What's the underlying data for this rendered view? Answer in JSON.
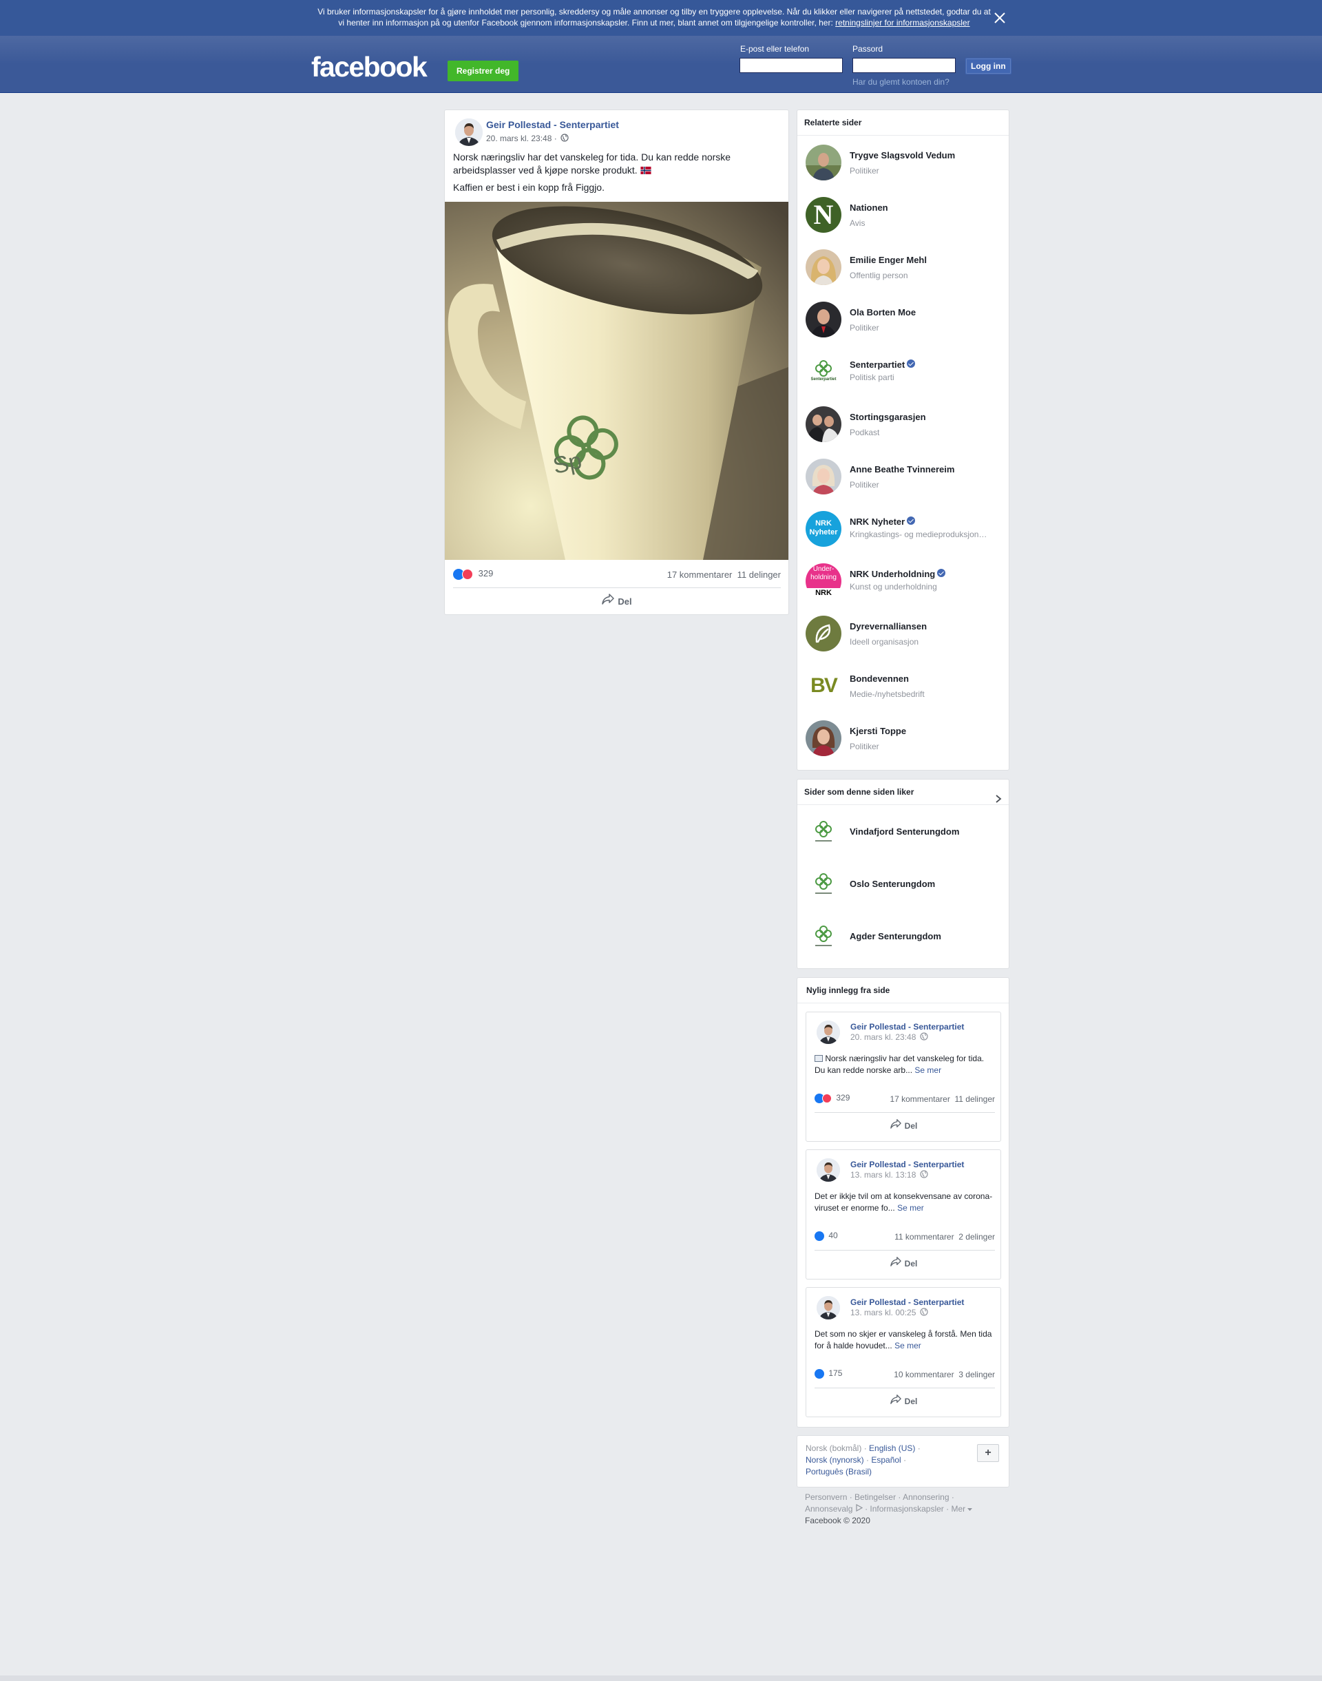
{
  "cookie_banner": {
    "line1": "Vi bruker informasjonskapsler for å gjøre innholdet mer personlig, skreddersy og måle annonser og tilby en tryggere opplevelse. Når du klikker eller navigerer på nettstedet, godtar du at",
    "line2": "vi henter inn informasjon på og utenfor Facebook gjennom informasjonskapsler. Finn ut mer, blant annet om tilgjengelige kontroller, her:",
    "link": "retningslinjer for informasjonskapsler"
  },
  "header": {
    "logo": "facebook",
    "register_label": "Registrer deg",
    "email_label": "E-post eller telefon",
    "password_label": "Passord",
    "email_value": "",
    "password_value": "",
    "login_label": "Logg inn",
    "forgot_label": "Har du glemt kontoen din?"
  },
  "post": {
    "author": "Geir Pollestad - Senterpartiet",
    "time": "20. mars kl. 23:48 ·",
    "text1": "Norsk næringsliv har det vanskeleg for tida. Du kan redde norske arbeidsplasser ved å kjøpe norske produkt.",
    "text2": "Kaffien er best i ein kopp frå Figgjo.",
    "reactions": "329",
    "comments": "17 kommentarer",
    "shares": "11 delinger",
    "share_label": "Del",
    "image_logo_text": "Sp"
  },
  "related": {
    "title": "Relaterte sider",
    "items": [
      {
        "name": "Trygve Slagsvold Vedum",
        "sub": "Politiker",
        "verified": false
      },
      {
        "name": "Nationen",
        "sub": "Avis",
        "verified": false
      },
      {
        "name": "Emilie Enger Mehl",
        "sub": "Offentlig person",
        "verified": false
      },
      {
        "name": "Ola Borten Moe",
        "sub": "Politiker",
        "verified": false
      },
      {
        "name": "Senterpartiet",
        "sub": "Politisk parti",
        "verified": true
      },
      {
        "name": "Stortingsgarasjen",
        "sub": "Podkast",
        "verified": false
      },
      {
        "name": "Anne Beathe Tvinnereim",
        "sub": "Politiker",
        "verified": false
      },
      {
        "name": "NRK Nyheter",
        "sub": "Kringkastings- og medieproduksjon…",
        "verified": true
      },
      {
        "name": "NRK Underholdning",
        "sub": "Kunst og underholdning",
        "verified": true
      },
      {
        "name": "Dyrevernalliansen",
        "sub": "Ideell organisasjon",
        "verified": false
      },
      {
        "name": "Bondevennen",
        "sub": "Medie-/nyhetsbedrift",
        "verified": false
      },
      {
        "name": "Kjersti Toppe",
        "sub": "Politiker",
        "verified": false
      }
    ],
    "logo_texts": {
      "nationen": "N",
      "senterpartiet": "Senterpartiet",
      "nrk_nyheter": [
        "NRK",
        "Nyheter"
      ],
      "nrk_underholdning": [
        "Under-",
        "holdning",
        "NRK"
      ],
      "bondevennen": "BV"
    }
  },
  "likes": {
    "title": "Sider som denne siden liker",
    "items": [
      {
        "name": "Vindafjord Senterungdom"
      },
      {
        "name": "Oslo Senterungdom"
      },
      {
        "name": "Agder Senterungdom"
      }
    ]
  },
  "recent": {
    "title": "Nylig innlegg fra side",
    "posts": [
      {
        "author": "Geir Pollestad - Senterpartiet",
        "time": "20. mars kl. 23:48",
        "text": "Norsk næringsliv har det vanskeleg for tida. Du kan redde norske arb...",
        "more": "Se mer",
        "reactions": "329",
        "comments": "17 kommentarer",
        "shares": "11 delinger",
        "love": true
      },
      {
        "author": "Geir Pollestad - Senterpartiet",
        "time": "13. mars kl. 13:18",
        "text": "Det er ikkje tvil om at konsekvensane av corona-viruset er enorme fo...",
        "more": "Se mer",
        "reactions": "40",
        "comments": "11 kommentarer",
        "shares": "2 delinger",
        "love": false
      },
      {
        "author": "Geir Pollestad - Senterpartiet",
        "time": "13. mars kl. 00:25",
        "text": "Det som no skjer er vanskeleg å forstå. Men tida for å halde hovudet...",
        "more": "Se mer",
        "reactions": "175",
        "comments": "10 kommentarer",
        "shares": "3 delinger",
        "love": false
      }
    ],
    "share_label": "Del"
  },
  "languages": {
    "current": "Norsk (bokmål)",
    "english": "English (US)",
    "nynorsk": "Norsk (nynorsk)",
    "espanol": "Español",
    "portugues": "Português (Brasil)",
    "plus": "+"
  },
  "footer": {
    "personvern": "Personvern",
    "betingelser": "Betingelser",
    "annonsering": "Annonsering",
    "annonsevalg": "Annonsevalg",
    "informasjonskapsler": "Informasjonskapsler",
    "mer": "Mer",
    "copyright": "Facebook © 2020"
  },
  "colors": {
    "brand_blue": "#3b5998",
    "link_blue": "#385898",
    "register_green": "#42b72a",
    "like_blue": "#1877f2",
    "love_red": "#f33e58",
    "page_bg": "#e9ebee"
  },
  "icons": {
    "close": "close-icon",
    "globe": "globe-icon",
    "share": "share-arrow-icon",
    "chevron": "chevron-right-icon",
    "verified": "verified-badge-icon",
    "like": "like-reaction-icon",
    "love": "love-reaction-icon"
  }
}
